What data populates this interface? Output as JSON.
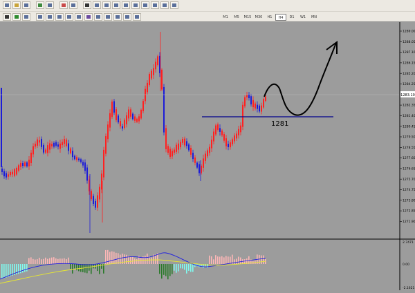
{
  "toolbar": {
    "timeframes": [
      "M1",
      "M5",
      "M15",
      "M30",
      "H1",
      "H4",
      "D1",
      "W1",
      "MN"
    ],
    "active_timeframe": "H4"
  },
  "chart": {
    "price_axis_labels": [
      "1289.00",
      "1288.05",
      "1287.10",
      "1286.15",
      "1285.20",
      "1284.25",
      "1283.30",
      "1282.35",
      "1281.40",
      "1280.45",
      "1279.50",
      "1278.55",
      "1277.60",
      "1276.65",
      "1275.70",
      "1274.75",
      "1273.80",
      "1272.85",
      "1271.90"
    ],
    "current_price_label": "1283.10",
    "support_level_label": "1281",
    "indicator_axis_labels": [
      "2.7471",
      "0.00",
      "-2.1621"
    ]
  },
  "colors": {
    "bull_candle": "#ff2020",
    "bear_candle": "#1c1cd8",
    "support_line": "#00008b",
    "drawing": "#000000",
    "hist_positive": "#ffb7b7",
    "hist_negative": "#7ffbf0",
    "hist_dark": "#2a7a2a",
    "signal_line": "#1e1ee0",
    "slow_line": "#e8e830"
  }
}
